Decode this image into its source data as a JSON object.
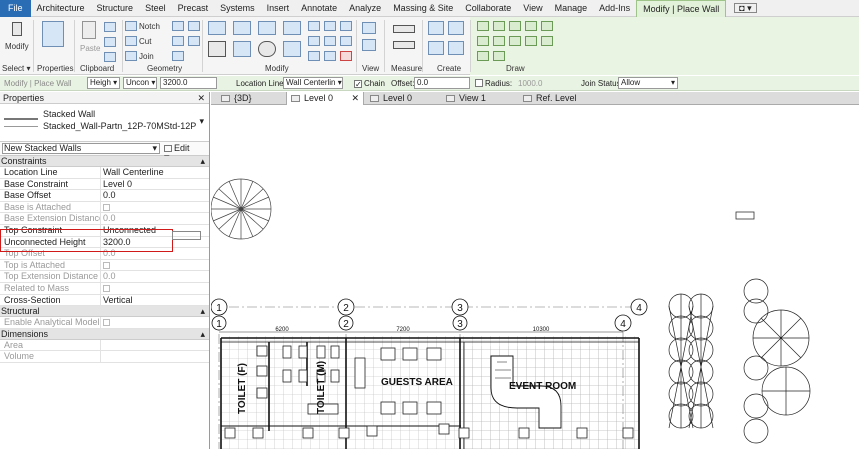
{
  "menu": {
    "tabs": [
      "File",
      "Architecture",
      "Structure",
      "Steel",
      "Precast",
      "Systems",
      "Insert",
      "Annotate",
      "Analyze",
      "Massing & Site",
      "Collaborate",
      "View",
      "Manage",
      "Add-Ins",
      "Modify | Place Wall"
    ]
  },
  "ribbon": {
    "modify_label": "Modify",
    "properties_label": "Properties",
    "notch_label": "Notch",
    "cut_label": "Cut",
    "join_label": "Join",
    "paste_label": "Paste",
    "panels": {
      "select": "Select",
      "properties": "Properties",
      "clipboard": "Clipboard",
      "geometry": "Geometry",
      "modify": "Modify",
      "view": "View",
      "measure": "Measure",
      "create": "Create",
      "draw": "Draw"
    }
  },
  "options_bar": {
    "context": "Modify | Place Wall",
    "height_mode": "Heigh",
    "top": "Uncon",
    "height_value": "3200.0",
    "location_line_label": "Location Line:",
    "location_line_value": "Wall Centerlin",
    "chain_label": "Chain",
    "offset_label": "Offset:",
    "offset_value": "0.0",
    "radius_label": "Radius:",
    "radius_value": "1000.0",
    "join_status_label": "Join Status:",
    "join_status_value": "Allow"
  },
  "properties_panel": {
    "title": "Properties",
    "family": "Stacked Wall",
    "type": "Stacked_Wall-Partn_12P-70MStd-12P",
    "instance_selector": "New Stacked Walls",
    "edit_type": "Edit Type",
    "categories": {
      "constraints": "Constraints",
      "structural": "Structural",
      "dimensions": "Dimensions"
    },
    "constraint_rows": [
      {
        "k": "Location Line",
        "v": "Wall Centerline",
        "dim": false
      },
      {
        "k": "Base Constraint",
        "v": "Level 0",
        "dim": false
      },
      {
        "k": "Base Offset",
        "v": "0.0",
        "dim": false
      },
      {
        "k": "Base is Attached",
        "v": "",
        "dim": true,
        "check": true
      },
      {
        "k": "Base Extension Distance",
        "v": "0.0",
        "dim": true
      },
      {
        "k": "Top Constraint",
        "v": "Unconnected",
        "dim": false
      },
      {
        "k": "Unconnected Height",
        "v": "3200.0",
        "dim": false
      },
      {
        "k": "Top Offset",
        "v": "0.0",
        "dim": true
      },
      {
        "k": "Top is Attached",
        "v": "",
        "dim": true,
        "check": true
      },
      {
        "k": "Top Extension Distance",
        "v": "0.0",
        "dim": true
      },
      {
        "k": "Related to Mass",
        "v": "",
        "dim": true,
        "check": true
      },
      {
        "k": "Cross-Section",
        "v": "Vertical",
        "dim": false
      }
    ],
    "structural_rows": [
      {
        "k": "Enable Analytical Model",
        "v": "",
        "dim": true,
        "check": true
      }
    ],
    "dimension_rows": [
      {
        "k": "Area",
        "v": "",
        "dim": true
      },
      {
        "k": "Volume",
        "v": "",
        "dim": true
      }
    ]
  },
  "view_tabs": [
    "{3D}",
    "Level 0",
    "Level 0",
    "View 1",
    "Ref. Level"
  ],
  "drawing": {
    "grid_labels": [
      "1",
      "2",
      "3",
      "4"
    ],
    "dimensions": [
      "6200",
      "7200",
      "10300"
    ],
    "rooms": [
      "TOILET (F)",
      "TOILET (M)",
      "GUESTS AREA",
      "EVENT ROOM"
    ]
  }
}
